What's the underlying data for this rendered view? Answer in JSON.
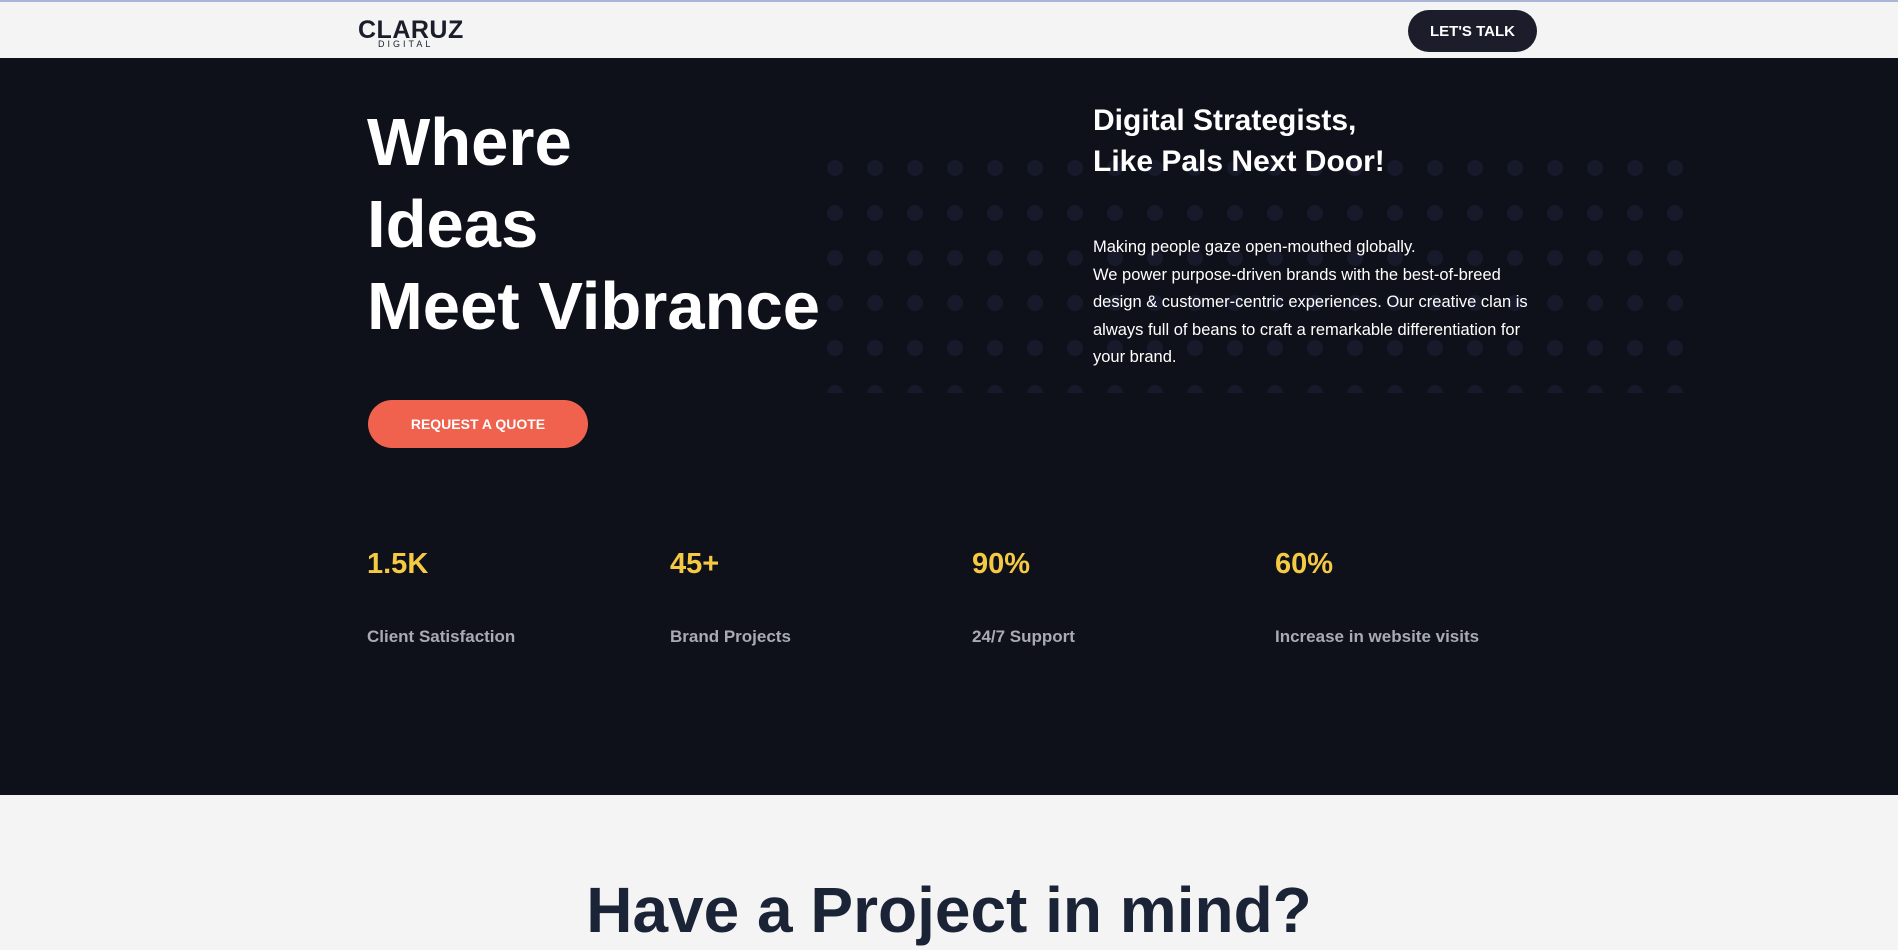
{
  "header": {
    "logo_main": "CLARUZ",
    "logo_sub": "DIGITAL",
    "talk_label": "LET'S TALK"
  },
  "hero": {
    "headline": [
      "Where",
      "Ideas",
      "Meet Vibrance"
    ],
    "quote_label": "REQUEST A QUOTE",
    "subtitle": [
      "Digital Strategists,",
      "Like Pals Next Door!"
    ],
    "description_line1": "Making people gaze open-mouthed globally.",
    "description_body": "We power purpose-driven brands with the best-of-breed design & customer-centric experiences. Our creative clan is always full of beans to craft a remarkable differentiation for your brand."
  },
  "stats": [
    {
      "value": "1.5K",
      "label": "Client Satisfaction"
    },
    {
      "value": "45+",
      "label": "Brand Projects"
    },
    {
      "value": "90%",
      "label": "24/7 Support"
    },
    {
      "value": "60%",
      "label": "Increase in website visits"
    }
  ],
  "cta": {
    "title": "Have a Project in mind?"
  },
  "colors": {
    "dark_bg": "#0f111a",
    "accent_coral": "#f0614e",
    "stat_yellow": "#f6c943",
    "button_dark": "#1b1d2b",
    "dot_default": "#171a2b",
    "dot_teal": "#2f5f6e",
    "dot_blue": "#343c86",
    "dot_olive": "#6b6434"
  }
}
